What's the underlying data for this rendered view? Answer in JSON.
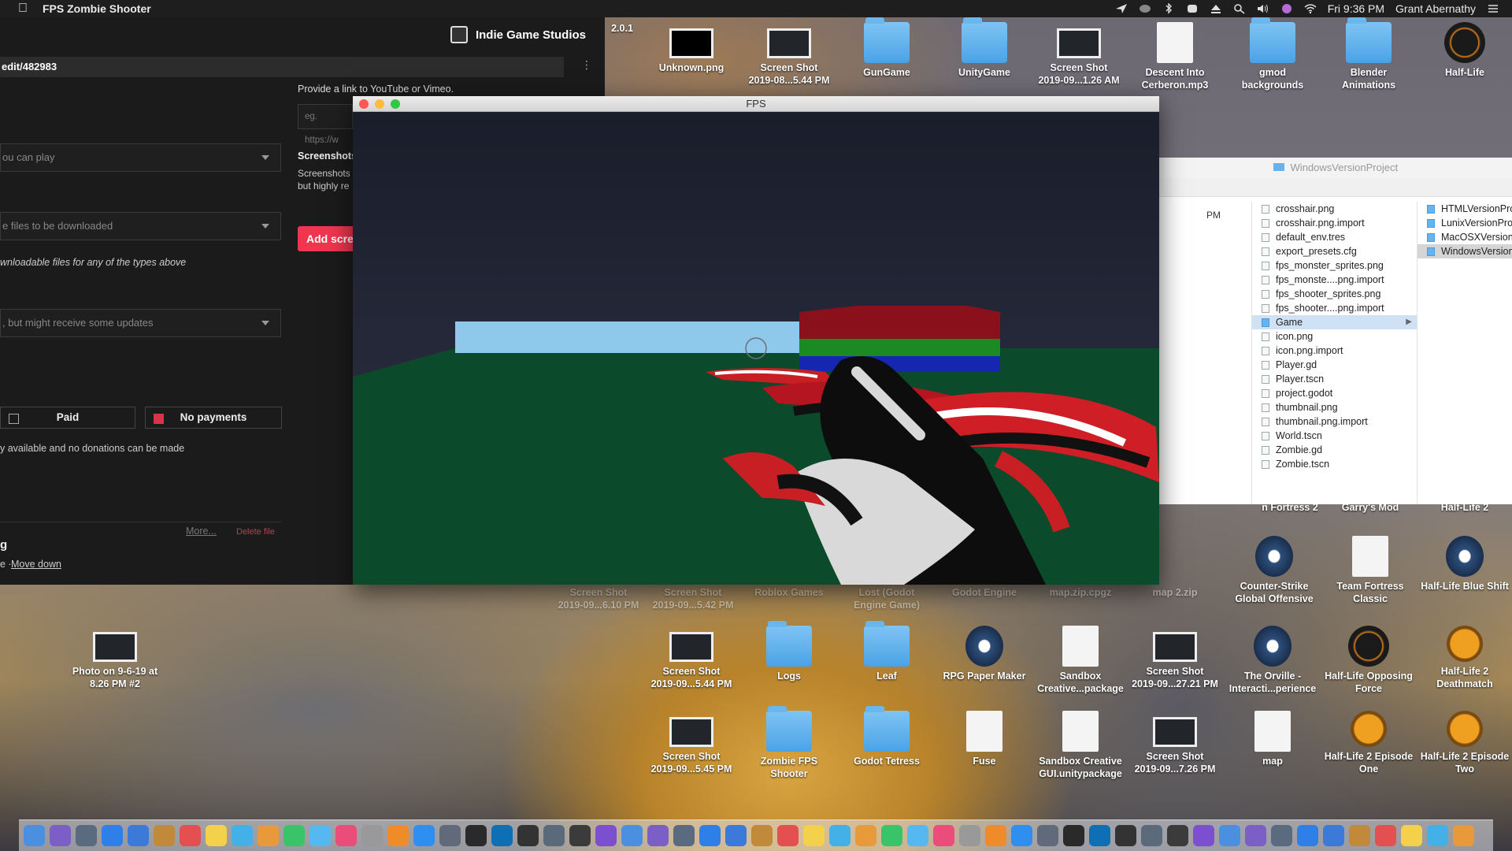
{
  "menubar": {
    "app_name": "FPS Zombie Shooter",
    "clock": "Fri 9:36 PM",
    "user": "Grant Abernathy"
  },
  "browser": {
    "studio_name": "Indie Game Studios",
    "url": "edit/482983",
    "video_hint": "Provide a link to YouTube or Vimeo.",
    "video_placeholder": "eg. https://w",
    "screenshots_title": "Screenshots",
    "screenshots_desc_1": "Screenshots",
    "screenshots_desc_2": "but highly re",
    "add_screenshots_label": "Add scree",
    "kind_select": "ou can play",
    "download_select": "e files to be downloaded",
    "no_downloadable_note": "wnloadable files for any of the types above",
    "release_select": ", but might receive some updates",
    "paid_label": "Paid",
    "no_payments_label": "No payments",
    "payments_note": "y available and no donations can be made",
    "more_link": "More...",
    "delete_file": "Delete file",
    "heading_fragment": "g",
    "move_prefix": "e · ",
    "move_down": "Move down"
  },
  "game_window": {
    "title": "FPS"
  },
  "finder": {
    "title": "WindowsVersionProject",
    "times": [
      "PM"
    ],
    "files": [
      "crosshair.png",
      "crosshair.png.import",
      "default_env.tres",
      "export_presets.cfg",
      "fps_monster_sprites.png",
      "fps_monste....png.import",
      "fps_shooter_sprites.png",
      "fps_shooter....png.import",
      "Game",
      "icon.png",
      "icon.png.import",
      "Player.gd",
      "Player.tscn",
      "project.godot",
      "thumbnail.png",
      "thumbnail.png.import",
      "World.tscn",
      "Zombie.gd",
      "Zombie.tscn"
    ],
    "subfolders": [
      "HTMLVersionProe",
      "LunixVersionProje",
      "MacOSXVersionPr",
      "WindowsVersionP"
    ]
  },
  "desktop_top": [
    {
      "label": "2.0.1",
      "kind": "partial"
    },
    {
      "label": "Unknown.png",
      "kind": "black"
    },
    {
      "label": "Screen Shot\n2019-08...5.44 PM",
      "kind": "thumb"
    },
    {
      "label": "GunGame",
      "kind": "folder"
    },
    {
      "label": "UnityGame",
      "kind": "folder"
    },
    {
      "label": "Screen Shot\n2019-09...1.26 AM",
      "kind": "thumb"
    },
    {
      "label": "Descent Into\nCerberon.mp3",
      "kind": "doc"
    },
    {
      "label": "gmod\nbackgrounds",
      "kind": "folder"
    },
    {
      "label": "Blender\nAnimations",
      "kind": "folder"
    },
    {
      "label": "Half-Life",
      "kind": "hl"
    }
  ],
  "desktop_mid_right": [
    {
      "label": "n Fortress 2",
      "kind": "none"
    },
    {
      "label": "Garry's Mod",
      "kind": "none"
    },
    {
      "label": "Half-Life 2",
      "kind": "none"
    },
    {
      "label": "Counter-Strike\nGlobal Offensive",
      "kind": "csgo"
    },
    {
      "label": "Team Fortress\nClassic",
      "kind": "tfc"
    },
    {
      "label": "Half-Life Blue Shift",
      "kind": "steam"
    }
  ],
  "desktop_row_a": [
    {
      "label": "Screen Shot\n2019-09...6.10 PM"
    },
    {
      "label": "Screen Shot\n2019-09...5.42 PM"
    },
    {
      "label": "Roblox Games"
    },
    {
      "label": "Lost (Godot\nEngine Game)"
    },
    {
      "label": "Godot Engine"
    },
    {
      "label": "map.zip.cpgz"
    },
    {
      "label": "map 2.zip"
    }
  ],
  "desktop_row_b": [
    {
      "label": "Photo on 9-6-19 at\n8.26 PM #2",
      "kind": "thumb"
    },
    {
      "label": "Screen Shot\n2019-09...5.44 PM",
      "kind": "thumb"
    },
    {
      "label": "Logs",
      "kind": "folder"
    },
    {
      "label": "Leaf",
      "kind": "folder"
    },
    {
      "label": "RPG Paper Maker",
      "kind": "steam"
    },
    {
      "label": "Sandbox\nCreative...package",
      "kind": "doc"
    },
    {
      "label": "Screen Shot\n2019-09...27.21 PM",
      "kind": "thumb"
    },
    {
      "label": "The Orville -\nInteracti...perience",
      "kind": "steam"
    },
    {
      "label": "Half-Life Opposing\nForce",
      "kind": "hl"
    },
    {
      "label": "Half-Life 2\nDeathmatch",
      "kind": "hl2"
    }
  ],
  "desktop_row_c": [
    {
      "label": "Screen Shot\n2019-09...5.45 PM",
      "kind": "thumb"
    },
    {
      "label": "Zombie FPS\nShooter",
      "kind": "folder"
    },
    {
      "label": "Godot Tetress",
      "kind": "folder"
    },
    {
      "label": "Fuse",
      "kind": "doc"
    },
    {
      "label": "Sandbox Creative\nGUI.unitypackage",
      "kind": "doc"
    },
    {
      "label": "Screen Shot\n2019-09...7.26 PM",
      "kind": "thumb"
    },
    {
      "label": "map",
      "kind": "doc"
    },
    {
      "label": "Half-Life 2 Episode\nOne",
      "kind": "hl2"
    },
    {
      "label": "Half-Life 2 Episode\nTwo",
      "kind": "hl2"
    }
  ],
  "dock_count": 56
}
